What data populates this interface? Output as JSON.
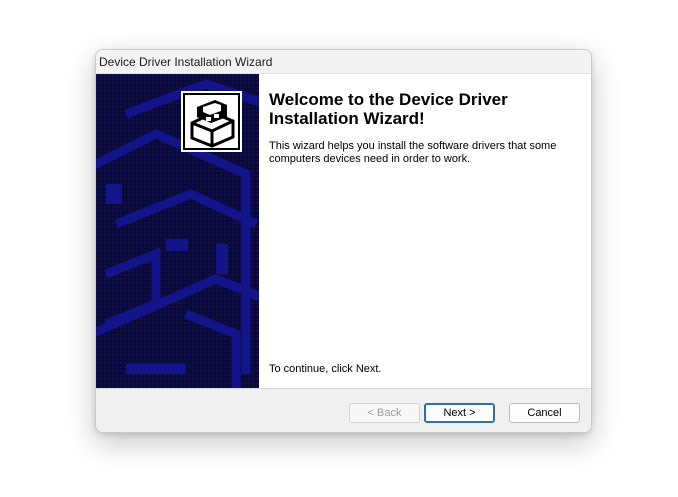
{
  "window": {
    "title": "Device Driver Installation Wizard"
  },
  "content": {
    "heading": "Welcome to the Device Driver Installation Wizard!",
    "description": "This wizard helps you install the software drivers that some computers devices need in order to work.",
    "continue_hint": "To continue, click Next."
  },
  "buttons": {
    "back_label": "< Back",
    "next_label": "Next >",
    "cancel_label": "Cancel"
  },
  "icons": {
    "banner_icon": "driver-install-box-icon"
  },
  "colors": {
    "banner_background": "#0a0a3a",
    "banner_pattern": "#14148a",
    "default_button_border": "#2a6fb8"
  }
}
